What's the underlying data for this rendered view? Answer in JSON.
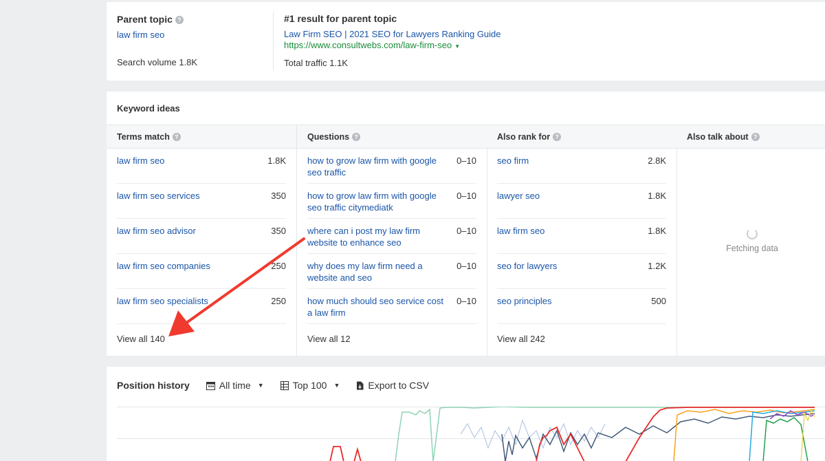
{
  "parent_topic": {
    "title": "Parent topic",
    "keyword": "law firm seo",
    "search_volume": "Search volume 1.8K",
    "result_title": "#1 result for parent topic",
    "result_link": "Law Firm SEO | 2021 SEO for Lawyers Ranking Guide",
    "result_url": "https://www.consultwebs.com/law-firm-seo",
    "total_traffic": "Total traffic 1.1K"
  },
  "keyword_ideas": {
    "title": "Keyword ideas",
    "columns": [
      {
        "header": "Terms match",
        "rows": [
          {
            "kw": "law firm seo",
            "num": "1.8K"
          },
          {
            "kw": "law firm seo services",
            "num": "350"
          },
          {
            "kw": "law firm seo advisor",
            "num": "350"
          },
          {
            "kw": "law firm seo companies",
            "num": "250"
          },
          {
            "kw": "law firm seo specialists",
            "num": "250"
          }
        ],
        "view_all": "View all 140"
      },
      {
        "header": "Questions",
        "rows": [
          {
            "kw": "how to grow law firm with google seo traffic",
            "num": "0–10"
          },
          {
            "kw": "how to grow law firm with google seo traffic citymediatk",
            "num": "0–10"
          },
          {
            "kw": "where can i post my law firm website to enhance seo",
            "num": "0–10"
          },
          {
            "kw": "why does my law firm need a website and seo",
            "num": "0–10"
          },
          {
            "kw": "how much should seo service cost a law firm",
            "num": "0–10"
          }
        ],
        "view_all": "View all 12"
      },
      {
        "header": "Also rank for",
        "rows": [
          {
            "kw": "seo firm",
            "num": "2.8K"
          },
          {
            "kw": "lawyer seo",
            "num": "1.8K"
          },
          {
            "kw": "law firm seo",
            "num": "1.8K"
          },
          {
            "kw": "seo for lawyers",
            "num": "1.2K"
          },
          {
            "kw": "seo principles",
            "num": "500"
          }
        ],
        "view_all": "View all 242"
      },
      {
        "header": "Also talk about",
        "fetching": "Fetching data"
      }
    ]
  },
  "position_history": {
    "title": "Position history",
    "time_filter": "All time",
    "top_filter": "Top 100",
    "export": "Export to CSV"
  },
  "colors": {
    "link": "#1a55a8",
    "url_green": "#1b8c3a",
    "annotation_arrow": "#f03a2e"
  }
}
